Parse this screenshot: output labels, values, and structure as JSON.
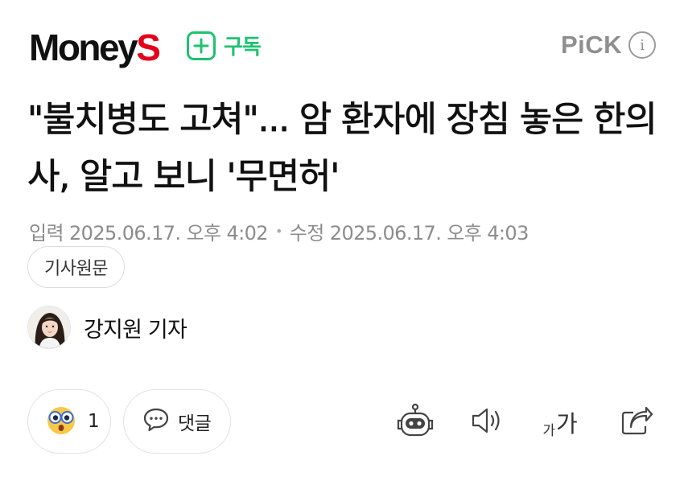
{
  "header": {
    "logo_text_money": "Money",
    "logo_text_s": "S",
    "subscribe_label": "구독",
    "pick_label": "PiCK",
    "info_label": "i"
  },
  "article": {
    "headline": "\"불치병도 고쳐\"... 암 환자에 장침 놓은 한의사, 알고 보니 '무면허'",
    "published": "입력 2025.06.17. 오후 4:02",
    "separator": "•",
    "modified": "수정 2025.06.17. 오후 4:03",
    "source_button": "기사원문",
    "reporter": "강지원 기자"
  },
  "actions": {
    "reaction_count": "1",
    "comment_label": "댓글",
    "font_small": "가",
    "font_big": "가"
  },
  "icons": {
    "reaction": "wow-face-icon",
    "comment": "speech-bubble-icon",
    "summary_bot": "robot-icon",
    "audio": "speaker-icon",
    "font_size": "font-size-icon",
    "share": "share-icon"
  },
  "colors": {
    "brand_red": "#e3001b",
    "subscribe_green": "#1ec271",
    "muted_gray": "#8c8c8c"
  }
}
